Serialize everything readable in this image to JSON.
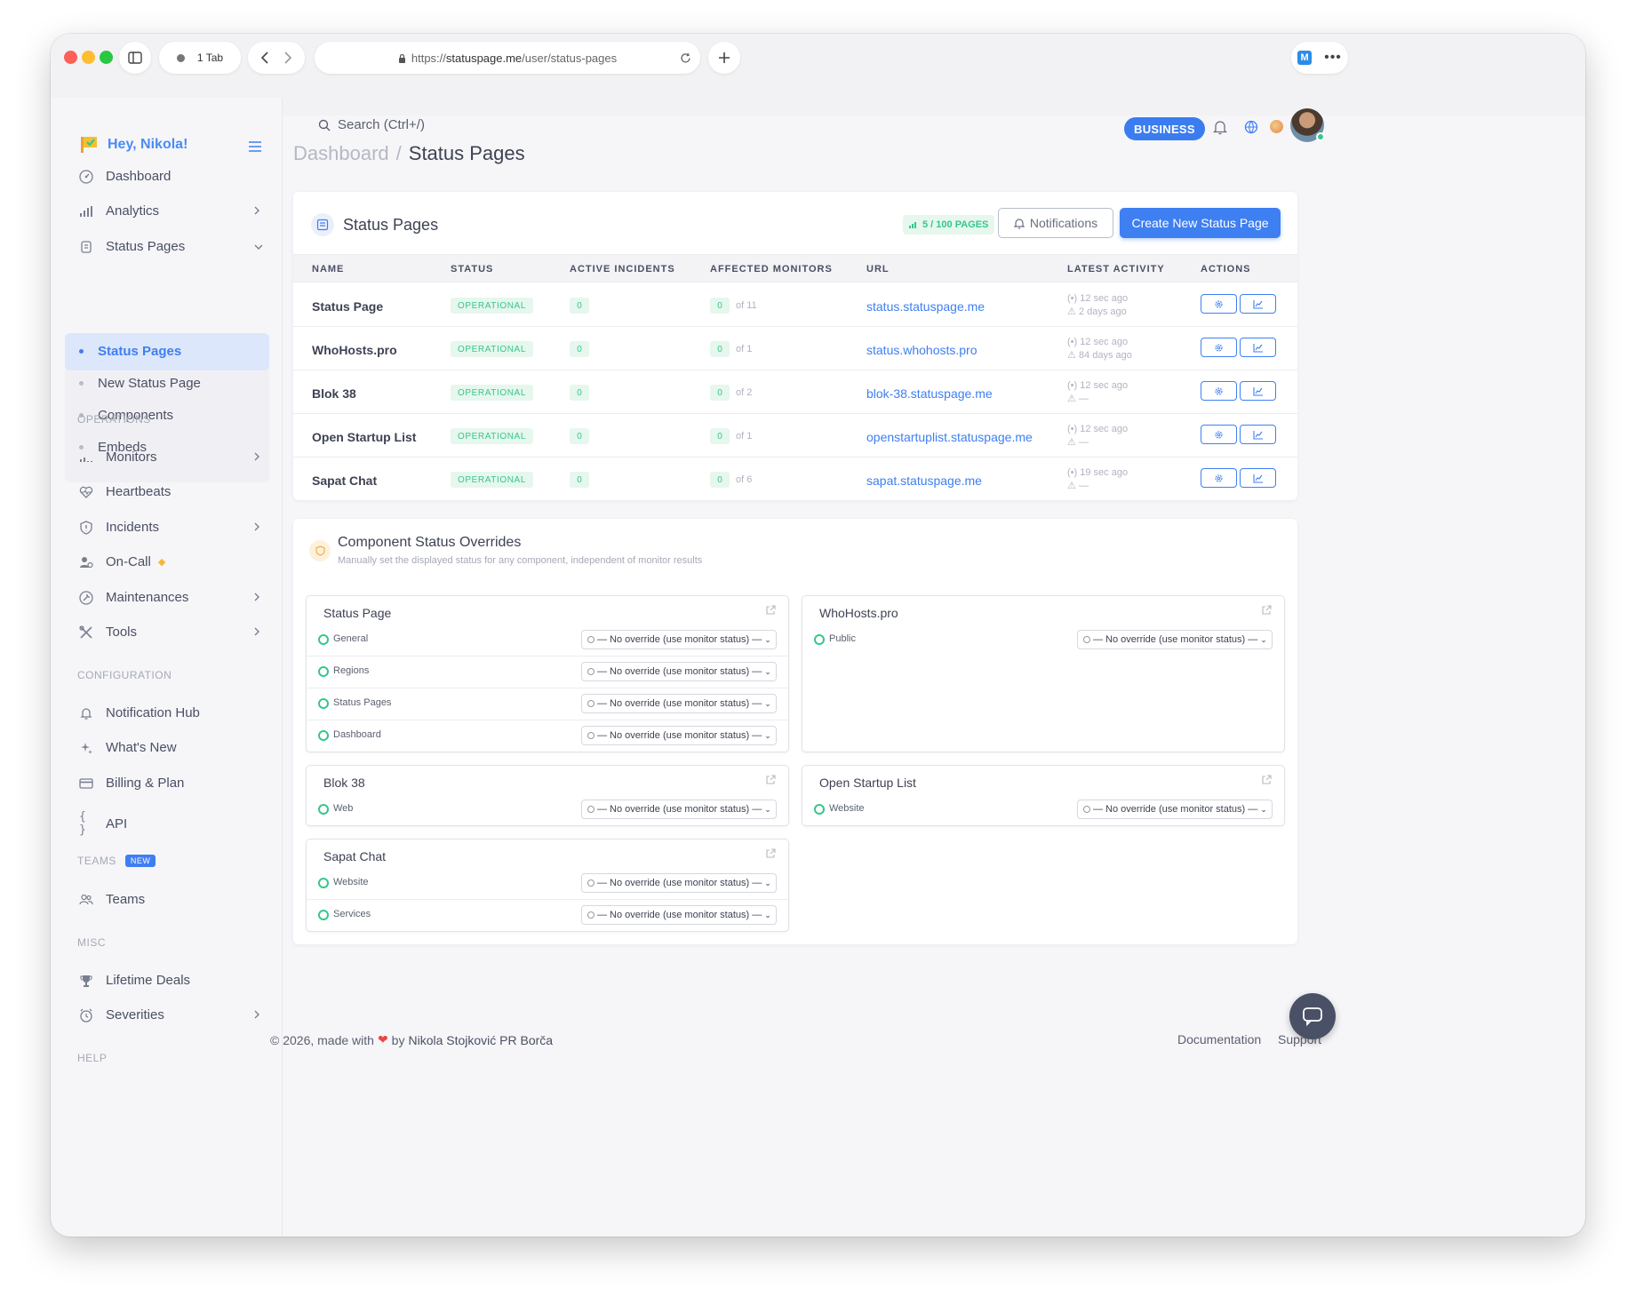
{
  "browser": {
    "tab_count": "1 Tab",
    "url_prefix": "https://",
    "url_host": "statuspage.me",
    "url_path": "/user/status-pages"
  },
  "brand": {
    "greeting": "Hey, Nikola!"
  },
  "sidebar": {
    "items": [
      {
        "label": "Dashboard",
        "icon": "dashboard-icon"
      },
      {
        "label": "Analytics",
        "icon": "bar-chart-icon"
      },
      {
        "label": "Status Pages",
        "icon": "status-pages-icon"
      }
    ],
    "status_pages_sub": [
      "Status Pages",
      "New Status Page",
      "Components",
      "Embeds"
    ],
    "operations_label": "OPERATIONS",
    "operations": [
      {
        "label": "Monitors",
        "icon": "monitors-icon"
      },
      {
        "label": "Heartbeats",
        "icon": "heartbeat-icon"
      },
      {
        "label": "Incidents",
        "icon": "shield-icon"
      },
      {
        "label": "On-Call",
        "icon": "on-call-icon"
      },
      {
        "label": "Maintenances",
        "icon": "maintenance-icon"
      },
      {
        "label": "Tools",
        "icon": "tools-icon"
      }
    ],
    "configuration_label": "CONFIGURATION",
    "configuration": [
      {
        "label": "Notification Hub",
        "icon": "bell-icon"
      },
      {
        "label": "What's New",
        "icon": "sparkles-icon"
      },
      {
        "label": "Billing & Plan",
        "icon": "card-icon"
      },
      {
        "label": "API",
        "icon": "braces-icon"
      }
    ],
    "teams_label": "TEAMS",
    "teams_badge": "NEW",
    "teams": [
      {
        "label": "Teams",
        "icon": "users-icon"
      }
    ],
    "misc_label": "MISC",
    "misc": [
      {
        "label": "Lifetime Deals",
        "icon": "trophy-icon"
      },
      {
        "label": "Severities",
        "icon": "alarm-icon"
      }
    ],
    "help_label": "HELP"
  },
  "topbar": {
    "search_placeholder": "Search (Ctrl+/)",
    "plan_badge": "BUSINESS"
  },
  "breadcrumb": {
    "parent": "Dashboard",
    "separator": "/",
    "current": "Status Pages"
  },
  "status_pages_card": {
    "title": "Status Pages",
    "pages_badge": "5 / 100 PAGES",
    "notifications_button": "Notifications",
    "create_button": "Create New Status Page",
    "columns": [
      "NAME",
      "STATUS",
      "ACTIVE INCIDENTS",
      "AFFECTED MONITORS",
      "URL",
      "LATEST ACTIVITY",
      "ACTIONS"
    ],
    "rows": [
      {
        "name": "Status Page",
        "status": "OPERATIONAL",
        "incidents": "0",
        "affected": "0",
        "of": "of 11",
        "url": "status.statuspage.me",
        "activity1": "12 sec ago",
        "activity2": "2 days ago"
      },
      {
        "name": "WhoHosts.pro",
        "status": "OPERATIONAL",
        "incidents": "0",
        "affected": "0",
        "of": "of 1",
        "url": "status.whohosts.pro",
        "activity1": "12 sec ago",
        "activity2": "84 days ago"
      },
      {
        "name": "Blok 38",
        "status": "OPERATIONAL",
        "incidents": "0",
        "affected": "0",
        "of": "of 2",
        "url": "blok-38.statuspage.me",
        "activity1": "12 sec ago",
        "activity2": "—"
      },
      {
        "name": "Open Startup List",
        "status": "OPERATIONAL",
        "incidents": "0",
        "affected": "0",
        "of": "of 1",
        "url": "openstartuplist.statuspage.me",
        "activity1": "12 sec ago",
        "activity2": "—"
      },
      {
        "name": "Sapat Chat",
        "status": "OPERATIONAL",
        "incidents": "0",
        "affected": "0",
        "of": "of 6",
        "url": "sapat.statuspage.me",
        "activity1": "19 sec ago",
        "activity2": "—"
      }
    ]
  },
  "overrides": {
    "title": "Component Status Overrides",
    "subtitle": "Manually set the displayed status for any component, independent of monitor results",
    "select_text": "— No override (use monitor status) —",
    "groups": [
      {
        "title": "Status Page",
        "components": [
          "General",
          "Regions",
          "Status Pages",
          "Dashboard"
        ]
      },
      {
        "title": "WhoHosts.pro",
        "components": [
          "Public"
        ]
      },
      {
        "title": "Blok 38",
        "components": [
          "Web"
        ]
      },
      {
        "title": "Open Startup List",
        "components": [
          "Website"
        ]
      },
      {
        "title": "Sapat Chat",
        "components": [
          "Website",
          "Services"
        ]
      }
    ]
  },
  "footer": {
    "copyright_pre": "© 2026, made with",
    "copyright_post": "by",
    "author": "Nikola Stojković PR Borča",
    "documentation": "Documentation",
    "support": "Support"
  },
  "colors": {
    "accent": "#3e7ff2",
    "success": "#35c78a",
    "sidebar_bg": "#f6f6f9"
  }
}
